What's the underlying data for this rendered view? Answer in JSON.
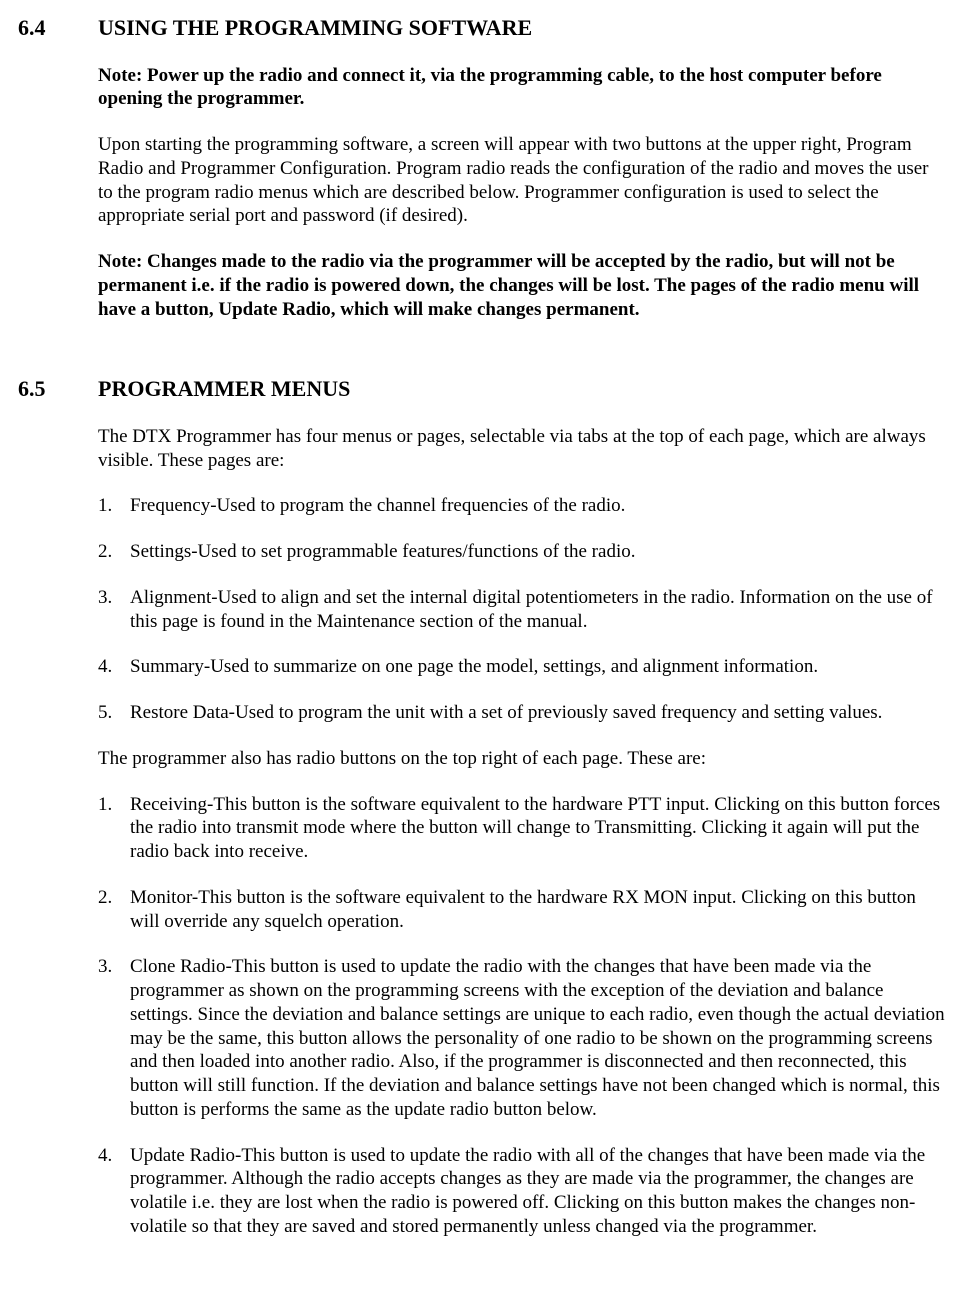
{
  "s64": {
    "num": "6.4",
    "title": "USING THE PROGRAMMING SOFTWARE",
    "note1": "Note:  Power up the radio and connect it, via the programming cable, to the host computer before opening the programmer.",
    "p1": "Upon starting the programming software, a screen will appear with two buttons at the upper right, Program Radio and Programmer Configuration.  Program radio reads the configuration of the radio and moves the user to the program radio menus which are described below.  Programmer configuration is used to select the appropriate serial port and password (if desired).",
    "note2": "Note:  Changes made to the radio via the programmer will be accepted by the radio, but will not be permanent i.e. if the radio is powered down, the changes will be lost. The pages of the radio menu will have a button, Update Radio, which will make changes permanent."
  },
  "s65": {
    "num": "6.5",
    "title": "PROGRAMMER MENUS",
    "p1": "The DTX Programmer has four menus or pages, selectable via tabs at the top of each page, which are always visible.  These pages are:",
    "listA": [
      {
        "n": "1.",
        "t": "Frequency-Used to program the channel frequencies of the radio."
      },
      {
        "n": "2.",
        "t": "Settings-Used to set programmable features/functions of the radio."
      },
      {
        "n": "3.",
        "t": "Alignment-Used to align and set the internal digital potentiometers in the radio.  Information on the use of this page is found in the Maintenance section of the manual."
      },
      {
        "n": "4.",
        "t": "Summary-Used to summarize on one page the model, settings, and alignment information."
      },
      {
        "n": "5.",
        "t": "Restore Data-Used to program the unit with a set of previously saved frequency  and setting values."
      }
    ],
    "p2": "The programmer also has radio buttons on the top right of each page. These are:",
    "listB": [
      {
        "n": "1.",
        "t": "Receiving-This button is the software equivalent to the hardware PTT input. Clicking on this button forces the radio into transmit mode where the button will change to Transmitting. Clicking it again will put the radio back into receive."
      },
      {
        "n": "2.",
        "t": "Monitor-This button is the software equivalent to the hardware RX MON input. Clicking on this button will override any squelch operation."
      },
      {
        "n": "3.",
        "t": "Clone Radio-This button is used to update the radio with the changes that have been made via the programmer as shown on the programming screens with the exception of the deviation and balance settings. Since the deviation and balance settings are unique to each radio, even though the actual deviation may be the same, this button allows the personality of one radio to be shown on the programming screens and then loaded into another radio. Also, if the programmer is disconnected and then reconnected, this button will still function. If the deviation and balance settings have not been changed which is normal, this button is performs the same as the update radio button below."
      },
      {
        "n": "4.",
        "t": "Update Radio-This button is used to update the radio with all of the changes that have been made via the programmer. Although the radio accepts changes as they are made via the programmer, the changes are volatile i.e. they are lost when the radio is powered off. Clicking on this button makes the changes non-volatile so that they are saved and stored permanently unless changed via the programmer."
      }
    ]
  }
}
